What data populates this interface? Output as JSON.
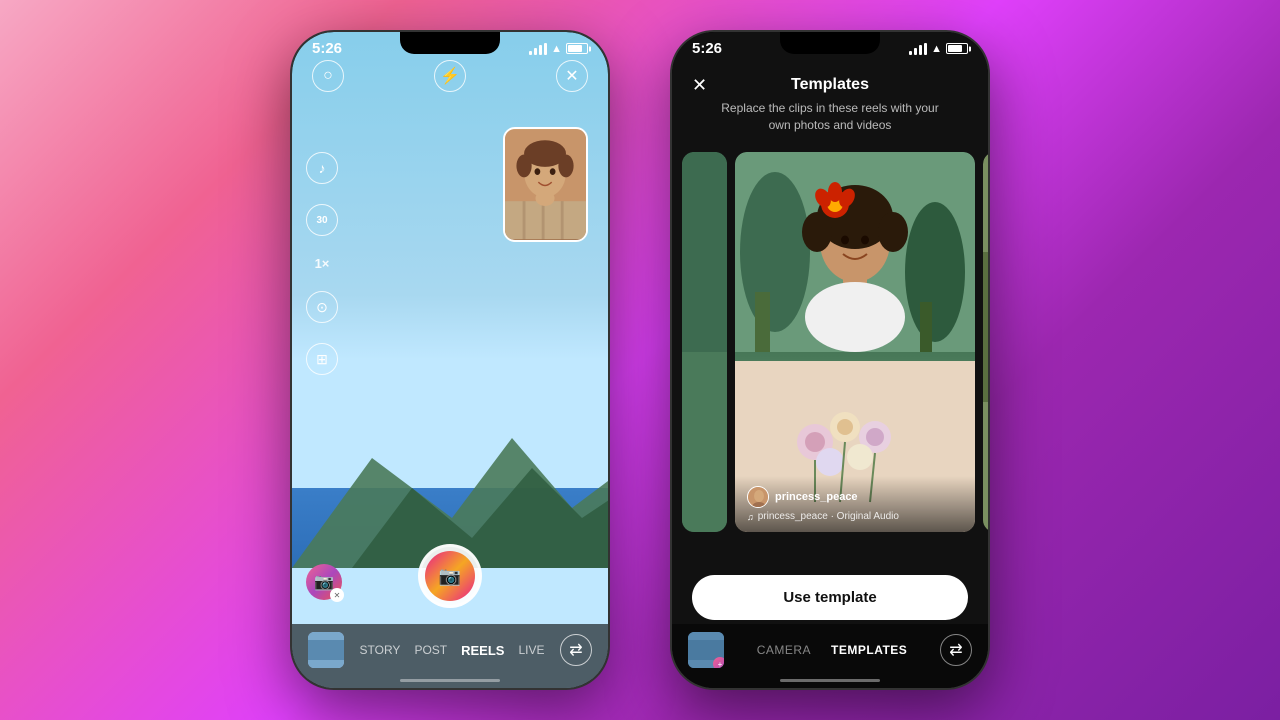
{
  "phone1": {
    "status_bar": {
      "time": "5:26"
    },
    "top_icons": {
      "ring_label": "○",
      "bolt_label": "⚡",
      "close_label": "✕"
    },
    "left_tools": [
      {
        "id": "music",
        "icon": "♪",
        "label": "music-icon"
      },
      {
        "id": "timer30",
        "text": "30",
        "label": "timer-icon"
      },
      {
        "id": "speed",
        "text": "1×",
        "label": "speed-icon"
      },
      {
        "id": "countdown",
        "icon": "⊙",
        "label": "countdown-icon"
      },
      {
        "id": "layout",
        "icon": "⊞",
        "label": "layout-icon"
      }
    ],
    "bottom_nav": {
      "items": [
        "STORY",
        "POST",
        "REELS",
        "LIVE"
      ],
      "active": "REELS"
    },
    "shutter": {
      "label": "📷"
    }
  },
  "phone2": {
    "status_bar": {
      "time": "5:26"
    },
    "header": {
      "close_label": "✕",
      "title": "Templates",
      "subtitle": "Replace the clips in these reels with your\nown photos and videos"
    },
    "template_card": {
      "username": "princess_peace",
      "audio": "princess_peace · Original Audio"
    },
    "use_template_button": "Use template",
    "bottom_nav": {
      "items": [
        "CAMERA",
        "TEMPLATES"
      ],
      "active": "TEMPLATES"
    }
  }
}
